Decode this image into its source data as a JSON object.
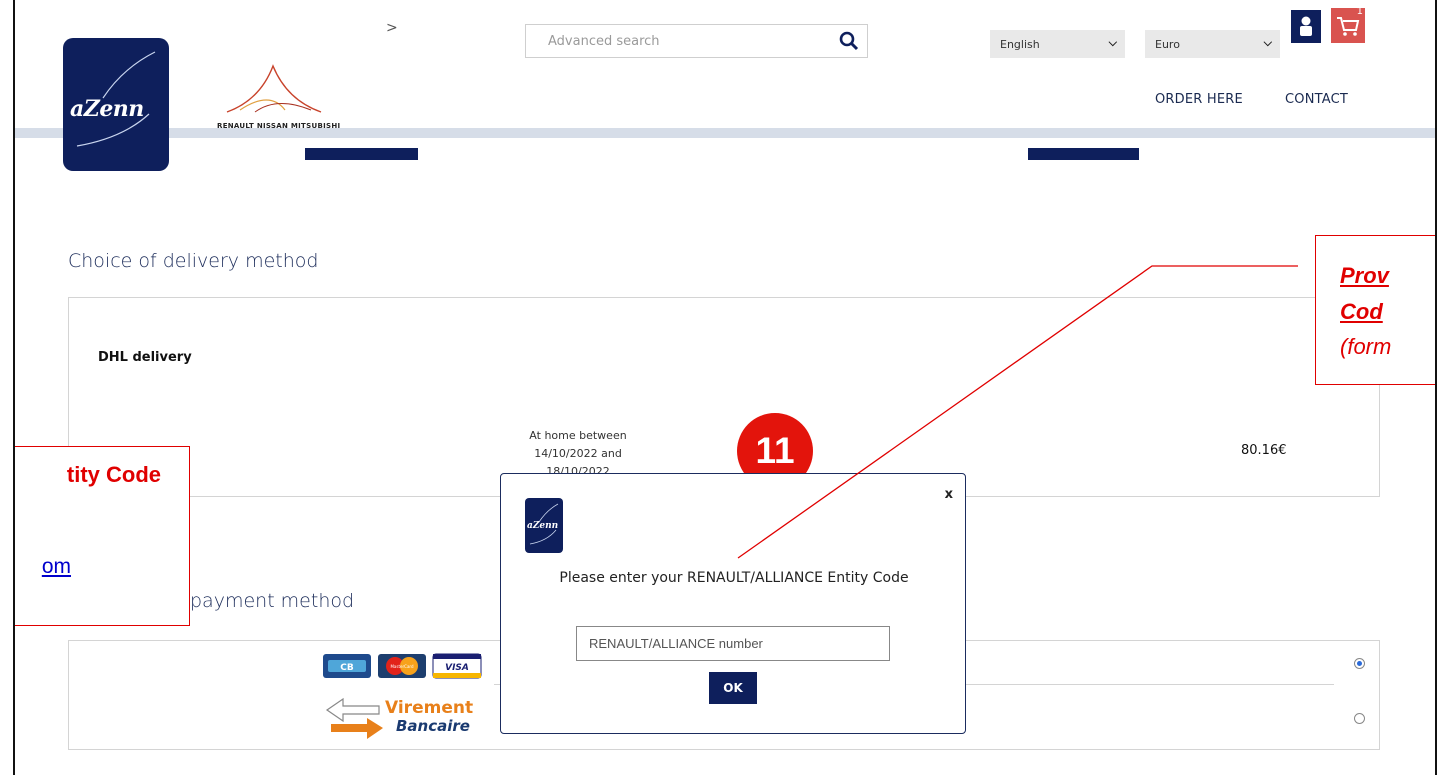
{
  "header": {
    "logo_text": "aZenn",
    "brand_text": "RENAULT NISSAN MITSUBISHI",
    "breadcrumb_chevron": ">",
    "search_placeholder": "Advanced search",
    "language": "English",
    "currency": "Euro",
    "cart_count": "1",
    "nav": [
      "ORDER HERE",
      "CONTACT"
    ]
  },
  "delivery": {
    "title": "Choice of delivery method",
    "method": "DHL delivery",
    "dates": [
      "At home between",
      "14/10/2022 and",
      "18/10/2022"
    ],
    "price": "80.16€"
  },
  "payment": {
    "title": "payment method",
    "card_logos": [
      "CB",
      "MasterCard",
      "VISA"
    ],
    "transfer_logo": [
      "Virement",
      "Bancaire"
    ],
    "selected_option": 0
  },
  "modal": {
    "logo_text": "aZenn",
    "close": "x",
    "message": "Please enter your RENAULT/ALLIANCE Entity Code",
    "input_placeholder": "RENAULT/ALLIANCE number",
    "ok_label": "OK"
  },
  "annotation": {
    "step": "11",
    "right_callout": [
      "Prov",
      "Cod",
      "(form"
    ],
    "left_callout": [
      "tity Code",
      "om"
    ]
  },
  "colors": {
    "navy": "#0e1f5c",
    "annotation_red": "#e00000",
    "cart_red": "#d9534f",
    "link_blue": "#0000cc"
  }
}
